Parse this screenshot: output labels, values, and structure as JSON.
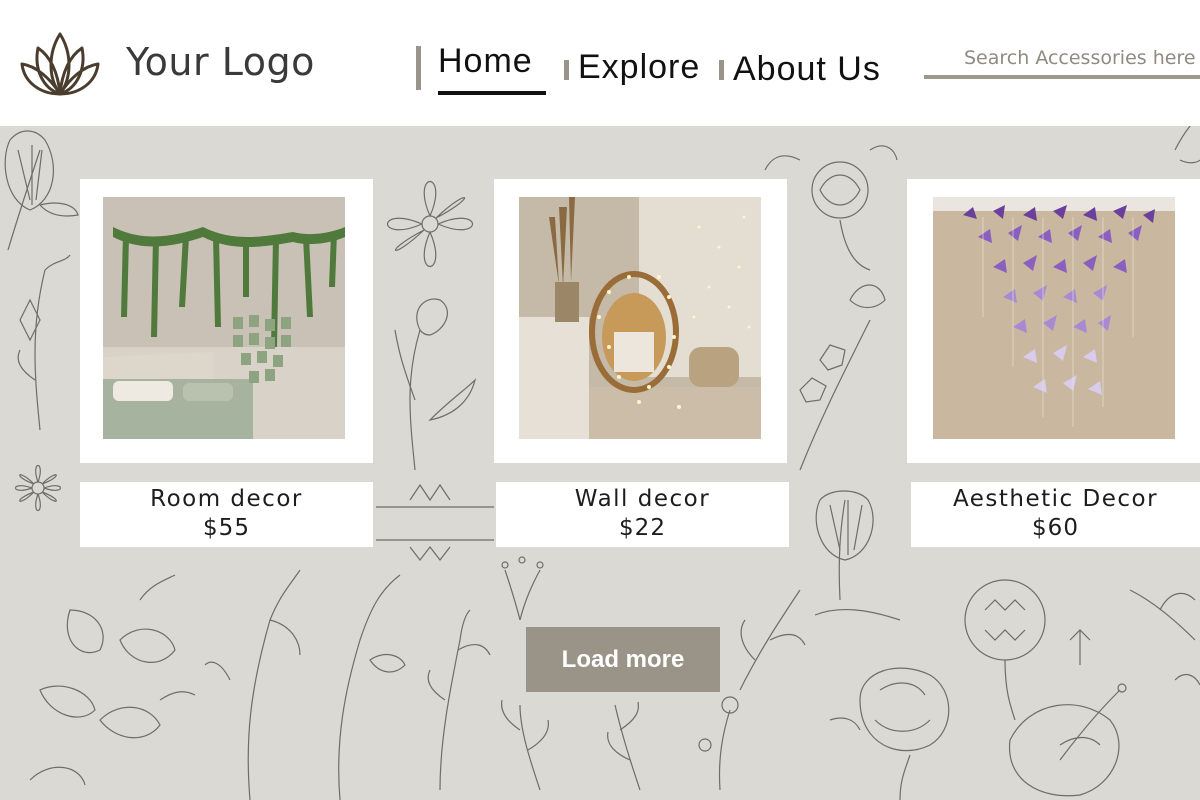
{
  "header": {
    "logo_text": "Your Logo",
    "logo_icon": "lotus-icon",
    "nav": [
      {
        "label": "Home",
        "active": true
      },
      {
        "label": "Explore",
        "active": false
      },
      {
        "label": "About Us",
        "active": false
      }
    ],
    "search": {
      "placeholder": "Search Accessories here",
      "value": ""
    }
  },
  "products": [
    {
      "name": "Room decor",
      "price": "$55"
    },
    {
      "name": "Wall decor",
      "price": "$22"
    },
    {
      "name": "Aesthetic Decor",
      "price": "$60"
    }
  ],
  "load_more_label": "Load more",
  "colors": {
    "background": "#dad9d4",
    "accent": "#9a9387",
    "nav_marker": "#9a948b",
    "search_underline": "#9e978c"
  }
}
